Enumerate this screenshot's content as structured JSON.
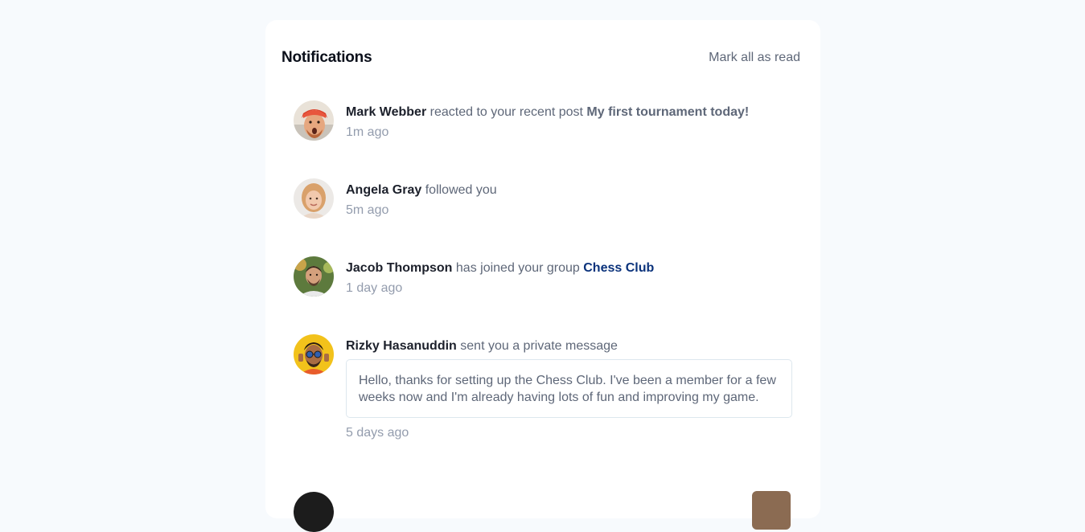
{
  "header": {
    "title": "Notifications",
    "mark_all_label": "Mark all as read"
  },
  "notifications": [
    {
      "user": "Mark Webber",
      "action": "reacted to your recent post",
      "target": "My first tournament today!",
      "time": "1m ago",
      "avatar_icon": "avatar-mark-webber"
    },
    {
      "user": "Angela Gray",
      "action": "followed you",
      "time": "5m ago",
      "avatar_icon": "avatar-angela-gray"
    },
    {
      "user": "Jacob Thompson",
      "action": "has joined your group",
      "target": "Chess Club",
      "time": "1 day ago",
      "avatar_icon": "avatar-jacob-thompson"
    },
    {
      "user": "Rizky Hasanuddin",
      "action": "sent you a private message",
      "message": "Hello, thanks for setting up the Chess Club. I've been a member for a few weeks now and I'm already having lots of fun and improving my game.",
      "time": "5 days ago",
      "avatar_icon": "avatar-rizky-hasanuddin"
    }
  ],
  "colors": {
    "background": "#f7fafd",
    "card": "#ffffff",
    "heading": "#1c202b",
    "text": "#5e6778",
    "time": "#939cad",
    "group_link": "#0a327b",
    "message_border": "#dde7ee"
  }
}
